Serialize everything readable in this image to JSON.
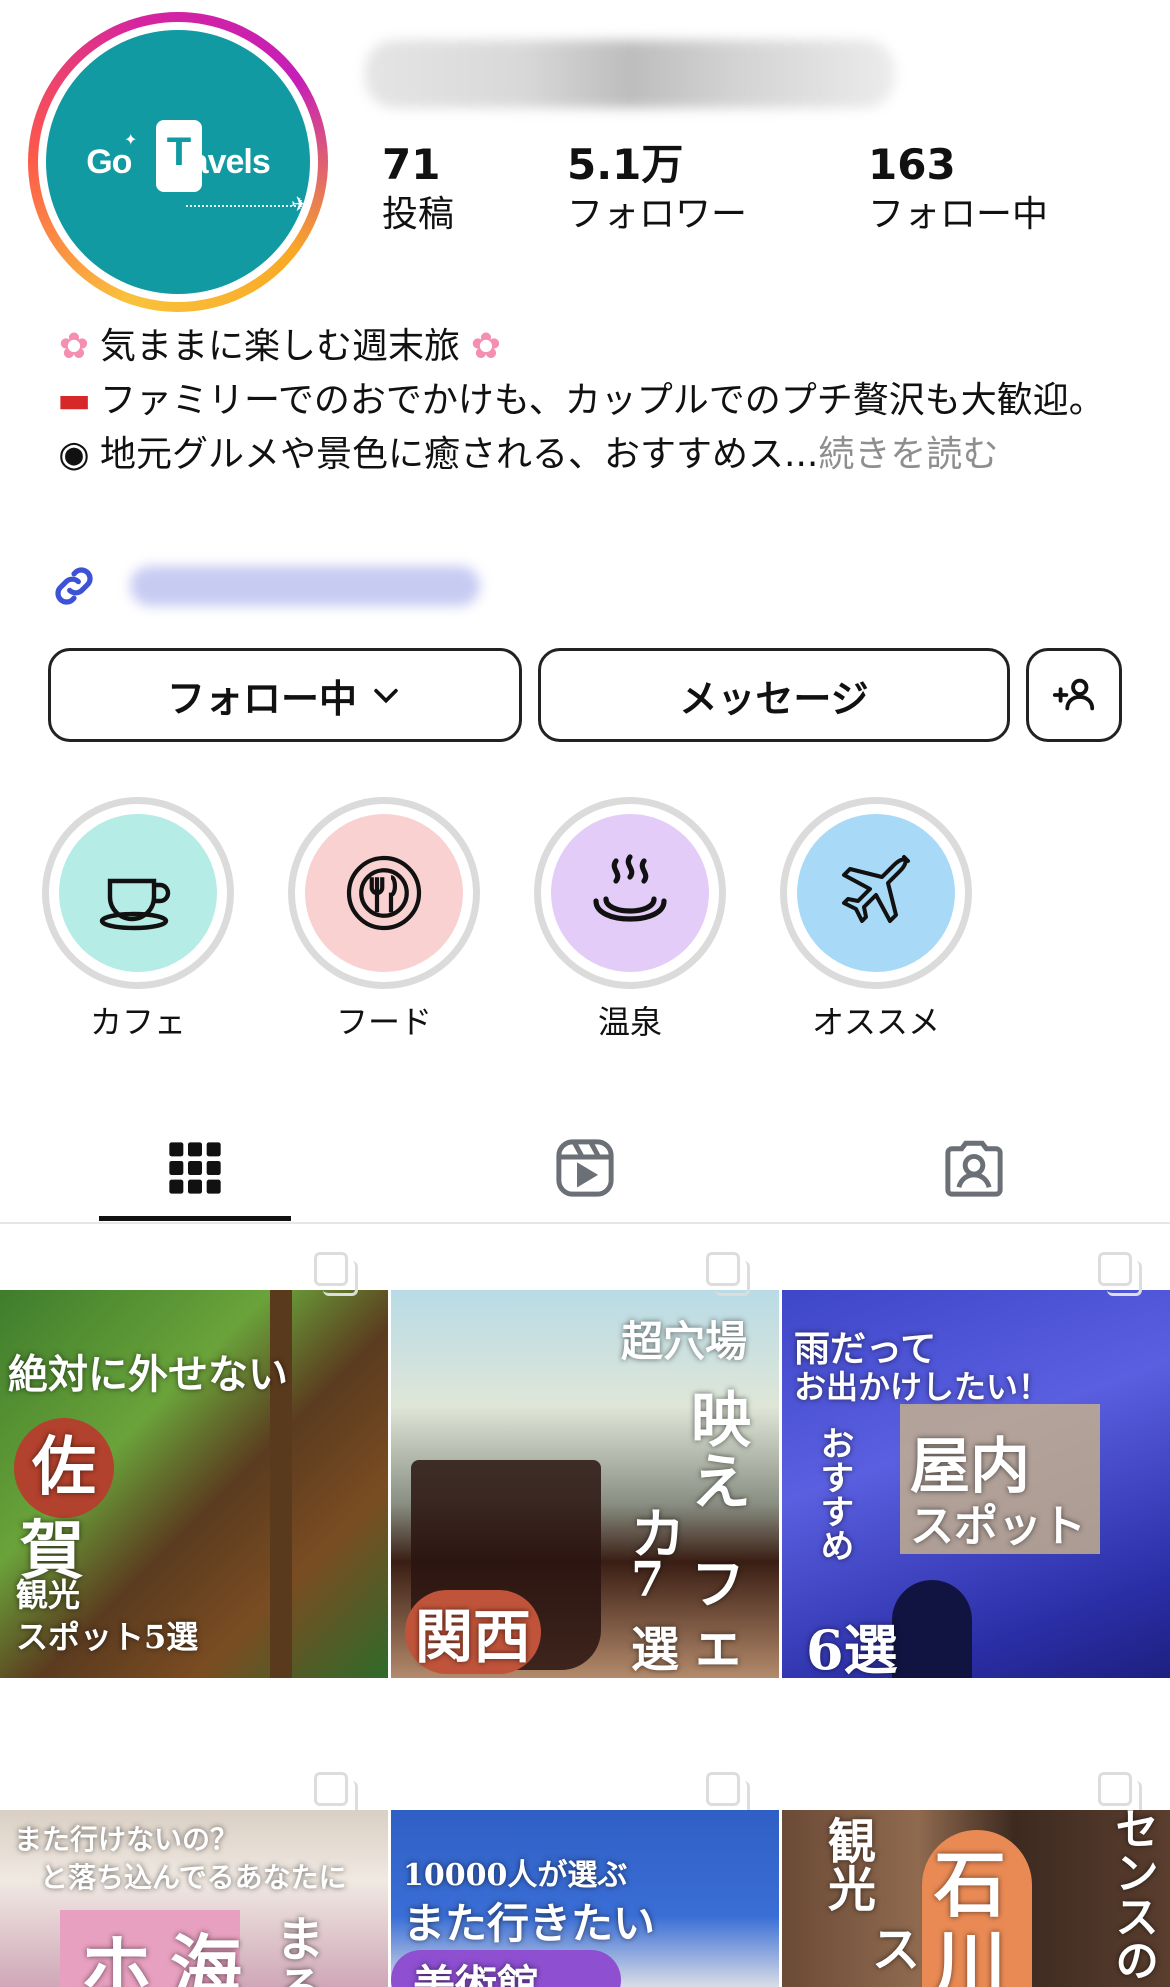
{
  "profile": {
    "logo_text_left": "Go",
    "logo_text_t": "T",
    "logo_text_right": "ravels",
    "stats": [
      {
        "value": "71",
        "label": "投稿"
      },
      {
        "value": "5.1万",
        "label": "フォロワー"
      },
      {
        "value": "163",
        "label": "フォロー中"
      }
    ],
    "bio": {
      "line1": "気ままに楽しむ週末旅",
      "line2": "ファミリーでのおでかけも、カップルでのプチ贅沢も大歓迎。",
      "line3": "地元グルメや景色に癒される、おすすめス...",
      "more": "続きを読む"
    }
  },
  "buttons": {
    "following": "フォロー中",
    "message": "メッセージ"
  },
  "highlights": [
    {
      "label": "カフェ",
      "color": "#b5ece6",
      "icon": "coffee-cup-icon"
    },
    {
      "label": "フード",
      "color": "#f9d1d1",
      "icon": "plate-cutlery-icon"
    },
    {
      "label": "温泉",
      "color": "#e3cdf8",
      "icon": "hot-spring-icon"
    },
    {
      "label": "オススメ",
      "color": "#a8daf8",
      "icon": "airplane-icon"
    }
  ],
  "tabs": [
    "grid-icon",
    "reels-icon",
    "tagged-icon"
  ],
  "posts": [
    {
      "lines": [
        "絶対に外せない",
        "佐",
        "賀",
        "観光",
        "スポット5選"
      ]
    },
    {
      "lines": [
        "超穴場",
        "映",
        "え",
        "カ",
        "フ",
        "ェ",
        "7",
        "選",
        "関西"
      ]
    },
    {
      "lines": [
        "雨だって",
        "お出かけしたい！",
        "屋内",
        "スポット",
        "おすすめ",
        "6選"
      ]
    },
    {
      "lines": [
        "また行けないの？",
        "と落ち込んでるあなたに",
        "ホ",
        "海",
        "ま",
        "る"
      ]
    },
    {
      "lines": [
        "10000人が選ぶ",
        "また行きたい",
        "美術館"
      ]
    },
    {
      "lines": [
        "観光",
        "ス",
        "石",
        "川",
        "センスの"
      ]
    }
  ],
  "colors": {
    "avatar_bg": "#129aa3",
    "link_icon": "#3d52d5",
    "more_text": "#8e8e8e"
  }
}
